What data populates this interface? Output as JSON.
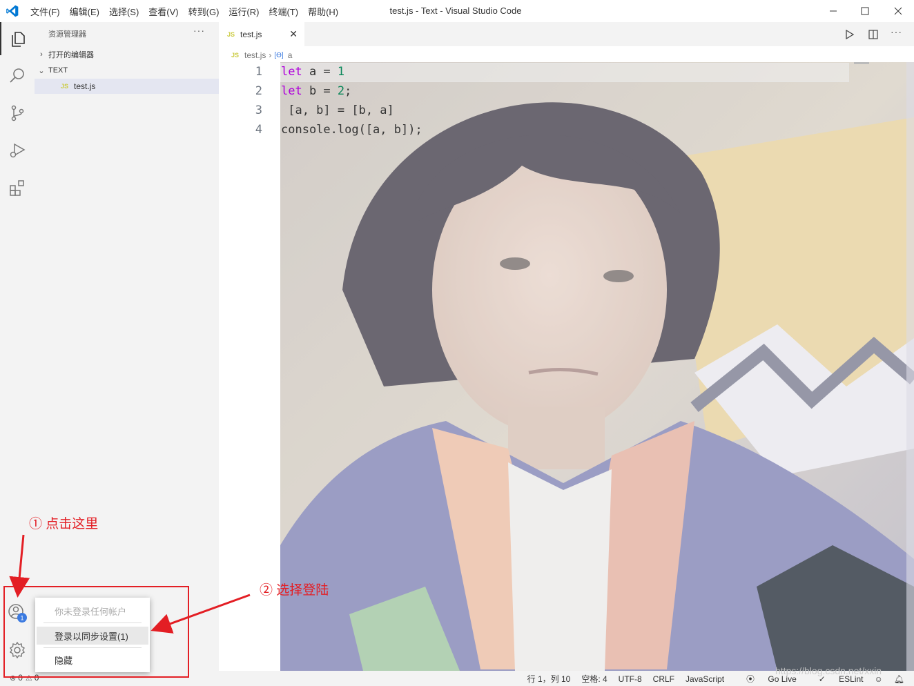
{
  "titlebar": {
    "title": "test.js - Text - Visual Studio Code",
    "menus": [
      "文件(F)",
      "编辑(E)",
      "选择(S)",
      "查看(V)",
      "转到(G)",
      "运行(R)",
      "终端(T)",
      "帮助(H)"
    ]
  },
  "sidebar": {
    "header": "资源管理器",
    "open_editors": "打开的编辑器",
    "folder": "TEXT",
    "file": "test.js",
    "js_badge": "JS"
  },
  "editor": {
    "tab_label": "test.js",
    "breadcrumb_file": "test.js",
    "breadcrumb_symbol": "a",
    "line_numbers": [
      "1",
      "2",
      "3",
      "4"
    ],
    "lines": [
      {
        "kw": "let",
        "rest": " a = ",
        "num": "1",
        "tail": ""
      },
      {
        "kw": "let",
        "rest": " b = ",
        "num": "2",
        "tail": ";"
      },
      {
        "text": " [a, b] = [b, a]"
      },
      {
        "text": "console.log([a, b]);"
      }
    ]
  },
  "account_menu": {
    "not_signed_in": "你未登录任何帐户",
    "sign_in_sync": "登录以同步设置(1)",
    "hide": "隐藏",
    "badge": "1"
  },
  "statusbar": {
    "errors": "0",
    "warnings": "0",
    "position": "行 1，列 10",
    "spaces": "空格: 4",
    "encoding": "UTF-8",
    "eol": "CRLF",
    "language": "JavaScript",
    "golive": "Go Live",
    "eslint": "ESLint"
  },
  "annotations": {
    "step1": "① 点击这里",
    "step2": "② 选择登陆",
    "color": "#e31e24"
  },
  "watermark": "https://blog.csdn.net/xxin"
}
